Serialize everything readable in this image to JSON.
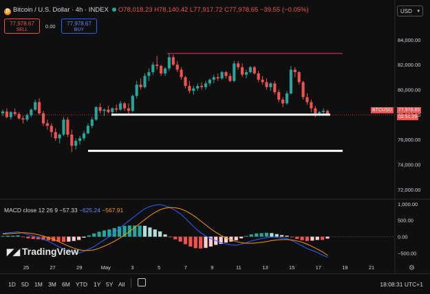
{
  "header": {
    "symbol_icon": "bitcoin-coin-icon",
    "title": "Bitcoin / U.S. Dollar · 4h · INDEX",
    "open": "O78,018.23",
    "high": "H78,140.42",
    "low": "L77,917.72",
    "close": "C77,978.65",
    "change": "−39.55 (−0.05%)"
  },
  "currency": "USD",
  "trade": {
    "sell_price": "77,978.67",
    "sell_label": "SELL",
    "spread": "0.00",
    "buy_price": "77,978.67",
    "buy_label": "BUY"
  },
  "macd_header": {
    "label": "MACD close 12 26 9",
    "histogram": "−57.33",
    "macd": "−625.24",
    "signal": "−567.91"
  },
  "price_tag": {
    "symbol": "BTCUSD",
    "price": "77,978.65",
    "countdown": "02:51:29"
  },
  "brand": "TradingView",
  "timeframes": [
    "1D",
    "5D",
    "1M",
    "3M",
    "6M",
    "YTD",
    "1Y",
    "5Y",
    "All"
  ],
  "clock": "18:08:31 UTC+1",
  "colors": {
    "up": "#26a69a",
    "down": "#ef5350",
    "resistance": "#e0245e",
    "support": "#ffffff",
    "macd_line": "#2962ff",
    "signal_line": "#ff9800"
  },
  "chart_data": [
    {
      "type": "candlestick",
      "title": "Bitcoin / U.S. Dollar · 4h · INDEX",
      "y_ticks": [
        "84,000.00",
        "82,000.00",
        "80,000.00",
        "78,000.00",
        "76,000.00",
        "74,000.00",
        "72,000.00"
      ],
      "y_tick_values": [
        84000,
        82000,
        80000,
        78000,
        76000,
        74000,
        72000
      ],
      "x_ticks": [
        "25",
        "27",
        "29",
        "May",
        "3",
        "5",
        "7",
        "9",
        "11",
        "13",
        "15",
        "17",
        "19",
        "21"
      ],
      "ylim": [
        71500,
        85200
      ],
      "grid": false,
      "candles_ohlc": [
        [
          78100,
          78400,
          77900,
          78250
        ],
        [
          78250,
          78500,
          77700,
          77800
        ],
        [
          77800,
          78300,
          77600,
          78200
        ],
        [
          78200,
          78500,
          77900,
          78050
        ],
        [
          78050,
          78200,
          77600,
          77700
        ],
        [
          77700,
          77900,
          77300,
          77600
        ],
        [
          77600,
          78100,
          77450,
          77950
        ],
        [
          77950,
          78500,
          77800,
          78400
        ],
        [
          78400,
          79200,
          78300,
          79000
        ],
        [
          79000,
          79300,
          78000,
          78100
        ],
        [
          78100,
          78300,
          77100,
          77300
        ],
        [
          77300,
          77600,
          76800,
          77100
        ],
        [
          77100,
          77300,
          76200,
          76600
        ],
        [
          76600,
          76900,
          75900,
          76100
        ],
        [
          76100,
          76500,
          75700,
          76400
        ],
        [
          76400,
          77800,
          76300,
          77600
        ],
        [
          77600,
          77800,
          76200,
          76400
        ],
        [
          76400,
          76800,
          75000,
          75500
        ],
        [
          75500,
          76100,
          75200,
          75900
        ],
        [
          75900,
          76300,
          75600,
          76100
        ],
        [
          76100,
          76700,
          75900,
          76500
        ],
        [
          76500,
          77300,
          76400,
          77100
        ],
        [
          77100,
          77800,
          76900,
          77600
        ],
        [
          77600,
          78700,
          77500,
          78600
        ],
        [
          78600,
          78900,
          78100,
          78300
        ],
        [
          78300,
          78500,
          77900,
          78400
        ],
        [
          78400,
          78700,
          78100,
          78200
        ],
        [
          78200,
          78600,
          77900,
          78500
        ],
        [
          78500,
          78800,
          78200,
          78400
        ],
        [
          78400,
          79100,
          78300,
          78900
        ],
        [
          78900,
          79000,
          78300,
          78500
        ],
        [
          78500,
          78900,
          78100,
          78300
        ],
        [
          78300,
          79600,
          78200,
          79500
        ],
        [
          79500,
          80700,
          79300,
          80400
        ],
        [
          80400,
          80900,
          80000,
          80200
        ],
        [
          80200,
          81300,
          80100,
          81100
        ],
        [
          81100,
          81700,
          80700,
          81400
        ],
        [
          81400,
          82200,
          81200,
          82000
        ],
        [
          82000,
          82700,
          81600,
          81900
        ],
        [
          81900,
          82000,
          81100,
          81300
        ],
        [
          81300,
          81800,
          81100,
          81700
        ],
        [
          81700,
          82900,
          81500,
          82600
        ],
        [
          82600,
          82800,
          81900,
          82000
        ],
        [
          82000,
          82300,
          81400,
          81600
        ],
        [
          81600,
          81800,
          80800,
          81000
        ],
        [
          81000,
          81100,
          80100,
          80300
        ],
        [
          80300,
          80700,
          79700,
          79900
        ],
        [
          79900,
          80300,
          79600,
          80100
        ],
        [
          80100,
          80500,
          79900,
          80300
        ],
        [
          80300,
          80600,
          80000,
          80200
        ],
        [
          80200,
          80700,
          80000,
          80500
        ],
        [
          80500,
          80900,
          80300,
          80800
        ],
        [
          80800,
          81200,
          80500,
          81000
        ],
        [
          81000,
          81300,
          80700,
          80900
        ],
        [
          80900,
          81500,
          80800,
          81400
        ],
        [
          81400,
          81500,
          80900,
          81100
        ],
        [
          81100,
          81300,
          80600,
          80700
        ],
        [
          80700,
          82300,
          80600,
          82100
        ],
        [
          82100,
          82300,
          81600,
          81800
        ],
        [
          81800,
          82100,
          81000,
          81200
        ],
        [
          81200,
          81600,
          80900,
          81400
        ],
        [
          81400,
          81900,
          81300,
          81800
        ],
        [
          81800,
          81900,
          81200,
          81300
        ],
        [
          81300,
          81500,
          80600,
          80800
        ],
        [
          80800,
          81100,
          80400,
          80600
        ],
        [
          80600,
          80900,
          80000,
          80200
        ],
        [
          80200,
          80600,
          79900,
          80500
        ],
        [
          80500,
          80700,
          79600,
          79800
        ],
        [
          79800,
          80000,
          79000,
          79200
        ],
        [
          79200,
          79400,
          78600,
          78900
        ],
        [
          78900,
          79900,
          78800,
          79700
        ],
        [
          79700,
          81900,
          79600,
          81600
        ],
        [
          81600,
          81800,
          81000,
          81400
        ],
        [
          81400,
          81500,
          80400,
          80600
        ],
        [
          80600,
          80700,
          79200,
          79400
        ],
        [
          79400,
          79700,
          78800,
          79000
        ],
        [
          79000,
          79200,
          78200,
          78500
        ],
        [
          78500,
          78700,
          77800,
          78100
        ],
        [
          78100,
          78300,
          77900,
          78200
        ],
        [
          78200,
          78500,
          77900,
          78300
        ],
        [
          78300,
          78400,
          77900,
          77978.65
        ]
      ],
      "annotations": {
        "resistance_level": 82900,
        "support_level_1": 78000,
        "support_level_2": 75100
      }
    },
    {
      "type": "histogram-line",
      "title": "MACD close 12 26 9",
      "y_ticks": [
        "1,000.00",
        "500.00",
        "0.00",
        "−500.00"
      ],
      "y_tick_values": [
        1000,
        500,
        0,
        -500
      ],
      "ylim": [
        -700,
        1100
      ],
      "series": [
        {
          "name": "MACD",
          "values": [
            100,
            120,
            130,
            150,
            110,
            60,
            20,
            -20,
            -80,
            -140,
            -220,
            -300,
            -380,
            -440,
            -480,
            -500,
            -450,
            -380,
            -300,
            -200,
            -100,
            0,
            120,
            260,
            380,
            500,
            620,
            740,
            850,
            920,
            960,
            980,
            940,
            880,
            800,
            700,
            560,
            400,
            250,
            120,
            20,
            -60,
            -120,
            -180,
            -220,
            -250,
            -260,
            -230,
            -180,
            -130,
            -90,
            -60,
            -30,
            -10,
            -20,
            -40,
            -60,
            -120,
            -200,
            -280,
            -360,
            -420,
            -480,
            -560,
            -625
          ]
        },
        {
          "name": "Signal",
          "values": [
            80,
            90,
            100,
            110,
            120,
            110,
            90,
            60,
            20,
            -30,
            -80,
            -150,
            -220,
            -290,
            -350,
            -400,
            -420,
            -420,
            -400,
            -350,
            -290,
            -220,
            -140,
            -50,
            50,
            160,
            280,
            400,
            520,
            640,
            740,
            820,
            870,
            890,
            880,
            850,
            790,
            700,
            600,
            480,
            360,
            240,
            130,
            40,
            -40,
            -100,
            -150,
            -180,
            -200,
            -200,
            -190,
            -170,
            -150,
            -120,
            -100,
            -90,
            -90,
            -100,
            -130,
            -170,
            -230,
            -300,
            -380,
            -460,
            -567.91
          ]
        }
      ],
      "histogram": [
        20,
        30,
        30,
        40,
        -10,
        -50,
        -70,
        -80,
        -100,
        -110,
        -140,
        -150,
        -160,
        -150,
        -130,
        -100,
        -30,
        40,
        100,
        150,
        190,
        220,
        260,
        310,
        330,
        340,
        340,
        340,
        330,
        280,
        220,
        160,
        70,
        -10,
        -80,
        -150,
        -230,
        -300,
        -350,
        -360,
        -340,
        -300,
        -250,
        -220,
        -180,
        -150,
        -110,
        -50,
        20,
        70,
        100,
        110,
        120,
        110,
        80,
        50,
        30,
        -20,
        -70,
        -110,
        -130,
        -120,
        -100,
        -100,
        -57.33
      ]
    }
  ]
}
